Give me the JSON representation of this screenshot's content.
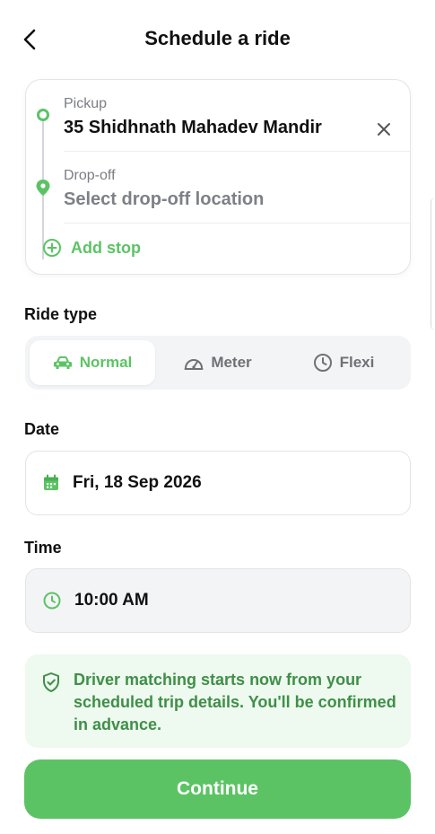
{
  "header": {
    "title": "Schedule a ride"
  },
  "route": {
    "pickup_label": "Pickup",
    "pickup_value": "35 Shidhnath Mahadev Mandir",
    "dropoff_label": "Drop-off",
    "dropoff_placeholder": "Select drop-off location",
    "add_stop_label": "Add stop"
  },
  "ride_type": {
    "label": "Ride type",
    "options": [
      {
        "label": "Normal",
        "icon": "car-icon",
        "selected": true
      },
      {
        "label": "Meter",
        "icon": "speedometer-icon",
        "selected": false
      },
      {
        "label": "Flexi",
        "icon": "clock-icon",
        "selected": false
      }
    ]
  },
  "date": {
    "label": "Date",
    "value": "Fri, 18 Sep 2026",
    "icon": "calendar-icon"
  },
  "time": {
    "label": "Time",
    "value": "10:00 AM",
    "icon": "clock-icon"
  },
  "notice": {
    "icon": "shield-check-icon",
    "text": "Driver matching starts now from your scheduled trip details. You'll be confirmed in advance."
  },
  "continue_label": "Continue",
  "colors": {
    "accent": "#5cc365",
    "notice_bg": "#eef9ef",
    "notice_text": "#3f8f48"
  }
}
